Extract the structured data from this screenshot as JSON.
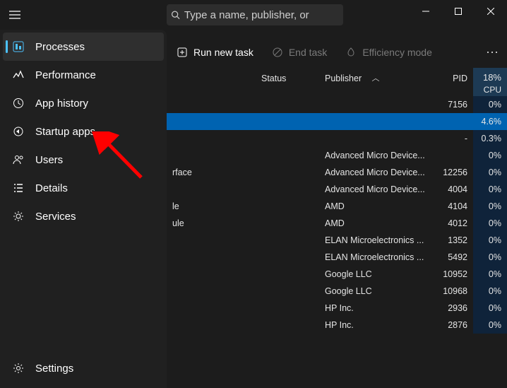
{
  "search": {
    "placeholder": "Type a name, publisher, or"
  },
  "sidebar": {
    "items": [
      {
        "label": "Processes"
      },
      {
        "label": "Performance"
      },
      {
        "label": "App history"
      },
      {
        "label": "Startup apps"
      },
      {
        "label": "Users"
      },
      {
        "label": "Details"
      },
      {
        "label": "Services"
      }
    ],
    "settings": "Settings"
  },
  "toolbar": {
    "run": "Run new task",
    "end": "End task",
    "eff": "Efficiency mode"
  },
  "columns": {
    "status": "Status",
    "publisher": "Publisher",
    "pid": "PID",
    "cpu_pct": "18%",
    "cpu": "CPU"
  },
  "rows": [
    {
      "name": "",
      "status": "",
      "publisher": "",
      "pid": "7156",
      "cpu": "0%"
    },
    {
      "name": "",
      "status": "",
      "publisher": "",
      "pid": "",
      "cpu": "4.6%",
      "sel": true
    },
    {
      "name": "",
      "status": "",
      "publisher": "",
      "pid": "-",
      "cpu": "0.3%"
    },
    {
      "name": "",
      "status": "",
      "publisher": "Advanced Micro Device...",
      "pid": "",
      "cpu": "0%"
    },
    {
      "name": "rface",
      "status": "",
      "publisher": "Advanced Micro Device...",
      "pid": "12256",
      "cpu": "0%"
    },
    {
      "name": "",
      "status": "",
      "publisher": "Advanced Micro Device...",
      "pid": "4004",
      "cpu": "0%"
    },
    {
      "name": "le",
      "status": "",
      "publisher": "AMD",
      "pid": "4104",
      "cpu": "0%"
    },
    {
      "name": "ule",
      "status": "",
      "publisher": "AMD",
      "pid": "4012",
      "cpu": "0%"
    },
    {
      "name": "",
      "status": "",
      "publisher": "ELAN Microelectronics ...",
      "pid": "1352",
      "cpu": "0%"
    },
    {
      "name": "",
      "status": "",
      "publisher": "ELAN Microelectronics ...",
      "pid": "5492",
      "cpu": "0%"
    },
    {
      "name": "",
      "status": "",
      "publisher": "Google LLC",
      "pid": "10952",
      "cpu": "0%"
    },
    {
      "name": "",
      "status": "",
      "publisher": "Google LLC",
      "pid": "10968",
      "cpu": "0%"
    },
    {
      "name": "",
      "status": "",
      "publisher": "HP Inc.",
      "pid": "2936",
      "cpu": "0%"
    },
    {
      "name": "",
      "status": "",
      "publisher": "HP Inc.",
      "pid": "2876",
      "cpu": "0%"
    }
  ]
}
